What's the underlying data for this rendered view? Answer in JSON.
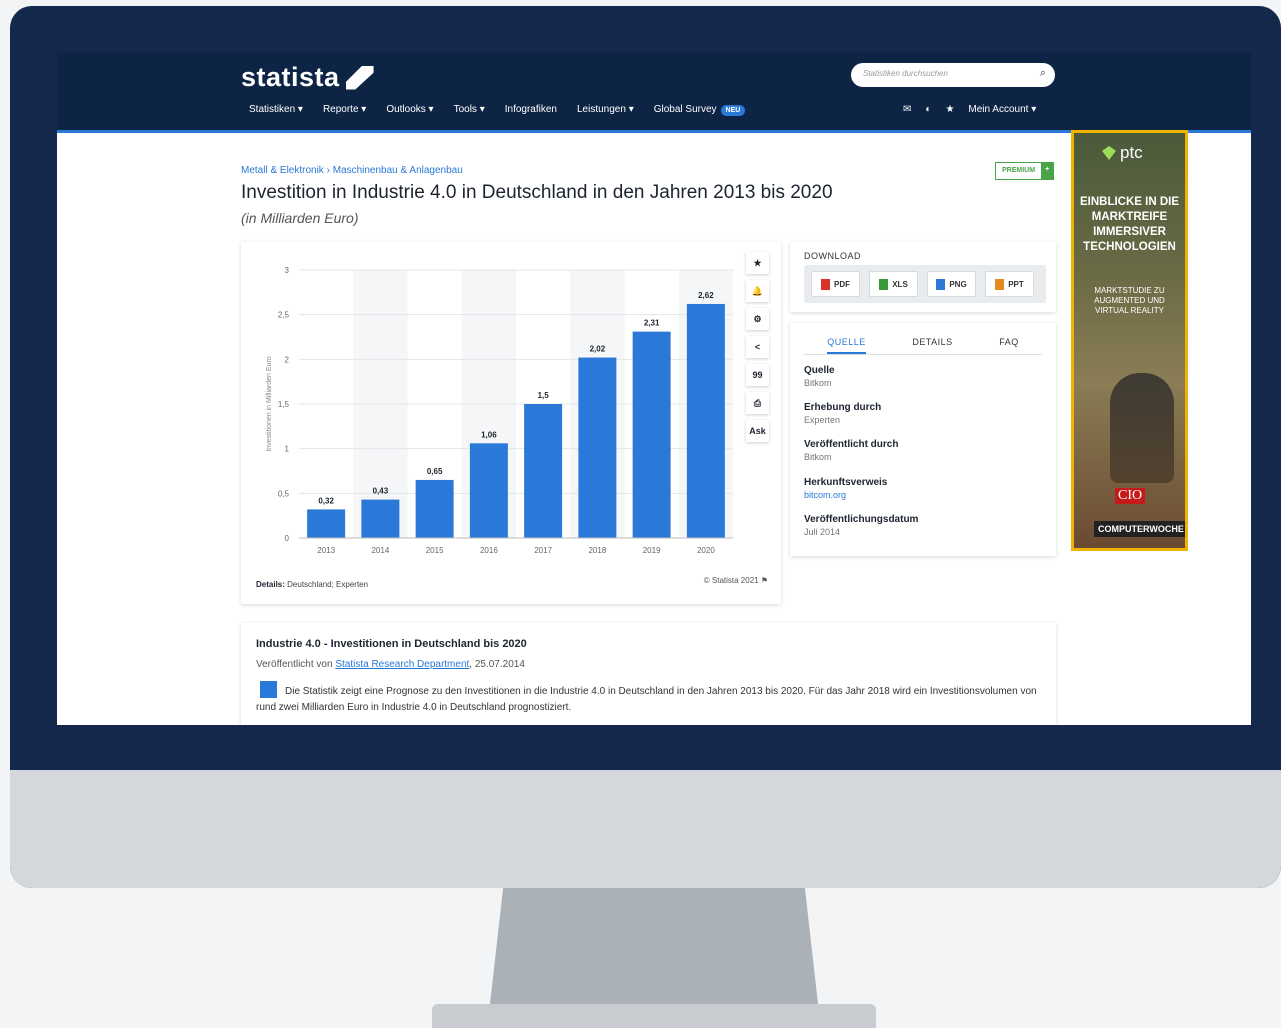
{
  "header": {
    "logo": "statista",
    "search_placeholder": "Statistiken durchsuchen",
    "nav": [
      "Statistiken ▾",
      "Reporte ▾",
      "Outlooks ▾",
      "Tools ▾",
      "Infografiken",
      "Leistungen ▾",
      "Global Survey"
    ],
    "nav_badge": "NEU",
    "account": "Mein Account ▾"
  },
  "breadcrumb": "Metall & Elektronik › Maschinenbau & Anlagenbau",
  "premium_label": "PREMIUM",
  "premium_plus": "+",
  "title": "Investition in Industrie 4.0 in Deutschland in den Jahren 2013 bis 2020",
  "subtitle": "(in Milliarden Euro)",
  "chart_data": {
    "type": "bar",
    "categories": [
      "2013",
      "2014",
      "2015",
      "2016",
      "2017",
      "2018",
      "2019",
      "2020"
    ],
    "values": [
      0.32,
      0.43,
      0.65,
      1.06,
      1.5,
      2.02,
      2.31,
      2.62
    ],
    "value_labels": [
      "0,32",
      "0,43",
      "0,65",
      "1,06",
      "1,5",
      "2,02",
      "2,31",
      "2,62"
    ],
    "ylabel": "Investitionen in Milliarden Euro",
    "yticks": [
      "0",
      "0,5",
      "1",
      "1,5",
      "2",
      "2,5",
      "3"
    ],
    "ylim": [
      0,
      3
    ],
    "bar_color": "#2a78d8",
    "grid": true
  },
  "chart_tools": [
    "★",
    "🔔",
    "⚙",
    "<",
    "99",
    "⎙",
    "Ask"
  ],
  "details_label": "Details:",
  "details_value": "Deutschland; Experten",
  "copyright": "© Statista 2021 ⚑",
  "download": {
    "title": "DOWNLOAD",
    "buttons": [
      "PDF",
      "XLS",
      "PNG",
      "PPT"
    ],
    "icon_colors": [
      "#d9332a",
      "#3a9b3a",
      "#2a78d8",
      "#e58a1f"
    ]
  },
  "source_tabs": [
    "QUELLE",
    "DETAILS",
    "FAQ"
  ],
  "source": {
    "quelle_k": "Quelle",
    "quelle_v": "Bitkom",
    "erhebung_k": "Erhebung durch",
    "erhebung_v": "Experten",
    "veroeff_k": "Veröffentlicht durch",
    "veroeff_v": "Bitkom",
    "herkunft_k": "Herkunftsverweis",
    "herkunft_v": "bitcom.org",
    "datum_k": "Veröffentlichungsdatum",
    "datum_v": "Juli 2014"
  },
  "ad": {
    "brand": "ptc",
    "headline": "EINBLICKE IN DIE MARKTREIFE IMMERSIVER TECHNOLOGIEN",
    "sub": "MARKTSTUDIE ZU AUGMENTED UND VIRTUAL REALITY",
    "cio": "CIO",
    "cw": "COMPUTERWOCHE"
  },
  "description": {
    "title": "Industrie 4.0 - Investitionen in Deutschland bis 2020",
    "pub_prefix": "Veröffentlicht von",
    "pub_link": "Statista Research Department",
    "pub_date": ", 25.07.2014",
    "text": "Die Statistik zeigt eine Prognose zu den Investitionen in die Industrie 4.0 in Deutschland in den Jahren 2013 bis 2020. Für das Jahr 2018 wird ein Investitionsvolumen von rund zwei Milliarden Euro in Industrie 4.0 in Deutschland prognostiziert."
  }
}
